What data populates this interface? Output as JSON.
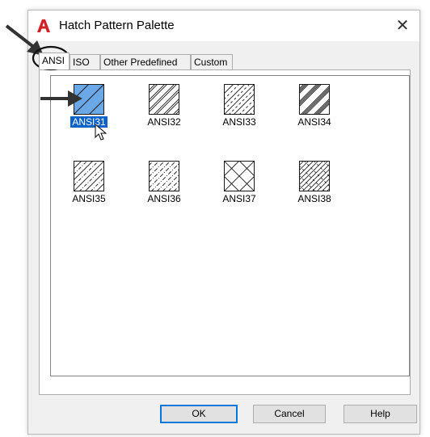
{
  "window": {
    "title": "Hatch Pattern Palette",
    "close_symbol": "✕",
    "app_icon": "autocad-a-icon"
  },
  "tabs": [
    {
      "label": "ANSI",
      "active": true
    },
    {
      "label": "ISO",
      "active": false
    },
    {
      "label": "Other Predefined",
      "active": false
    },
    {
      "label": "Custom",
      "active": false
    }
  ],
  "patterns": [
    {
      "label": "ANSI31",
      "selected": true
    },
    {
      "label": "ANSI32",
      "selected": false
    },
    {
      "label": "ANSI33",
      "selected": false
    },
    {
      "label": "ANSI34",
      "selected": false
    },
    {
      "label": "ANSI35",
      "selected": false
    },
    {
      "label": "ANSI36",
      "selected": false
    },
    {
      "label": "ANSI37",
      "selected": false
    },
    {
      "label": "ANSI38",
      "selected": false
    }
  ],
  "buttons": {
    "ok": "OK",
    "cancel": "Cancel",
    "help": "Help"
  },
  "colors": {
    "selection": "#0a63c9",
    "swatch_selected": "#6aa8e8",
    "app_icon": "#d32027"
  }
}
